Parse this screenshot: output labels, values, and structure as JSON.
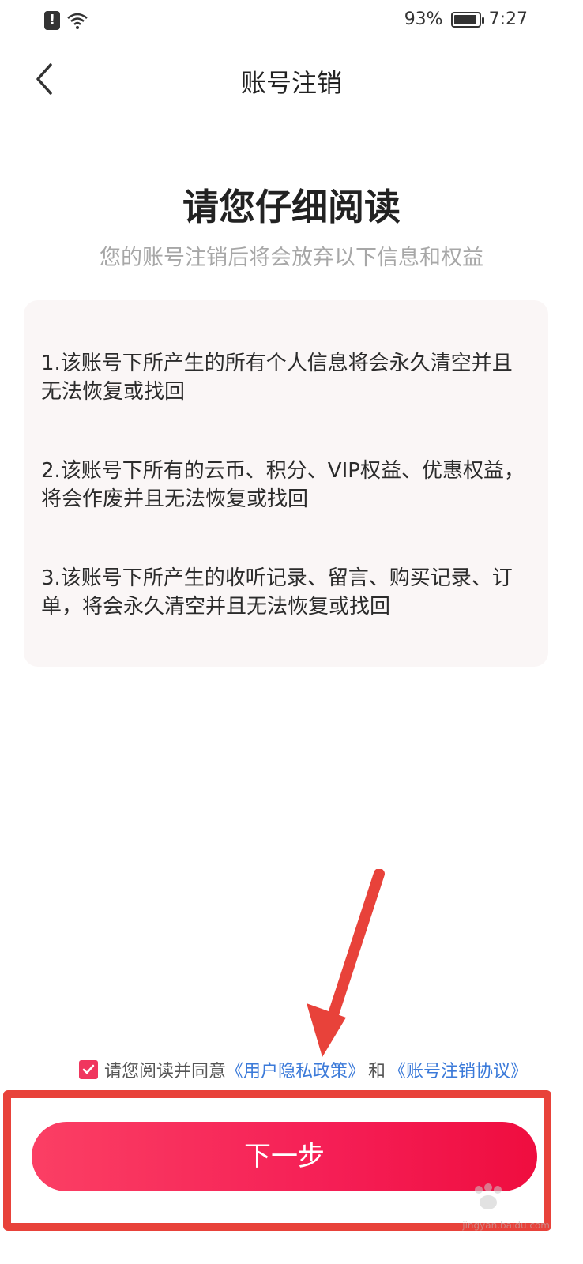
{
  "status_bar": {
    "battery_percent": "93%",
    "time": "7:27"
  },
  "nav": {
    "title": "账号注销"
  },
  "heading": "请您仔细阅读",
  "subheading": "您的账号注销后将会放弃以下信息和权益",
  "items": [
    {
      "text": "1.该账号下所产生的所有个人信息将会永久清空并且无法恢复或找回"
    },
    {
      "text": "2.该账号下所有的云币、积分、VIP权益、优惠权益，将会作废并且无法恢复或找回"
    },
    {
      "text": "3.该账号下所产生的收听记录、留言、购买记录、订单，将会永久清空并且无法恢复或找回"
    }
  ],
  "agreement": {
    "prefix": "请您阅读并同意",
    "privacy_link": "《用户隐私政策》",
    "and": "和",
    "cancel_link": "《账号注销协议》",
    "checked": true
  },
  "next_button": "下一步",
  "watermark": "jingyan.baidu.com",
  "colors": {
    "accent": "#f51e55",
    "link": "#3b7ad9",
    "annotation": "#e8423a"
  }
}
